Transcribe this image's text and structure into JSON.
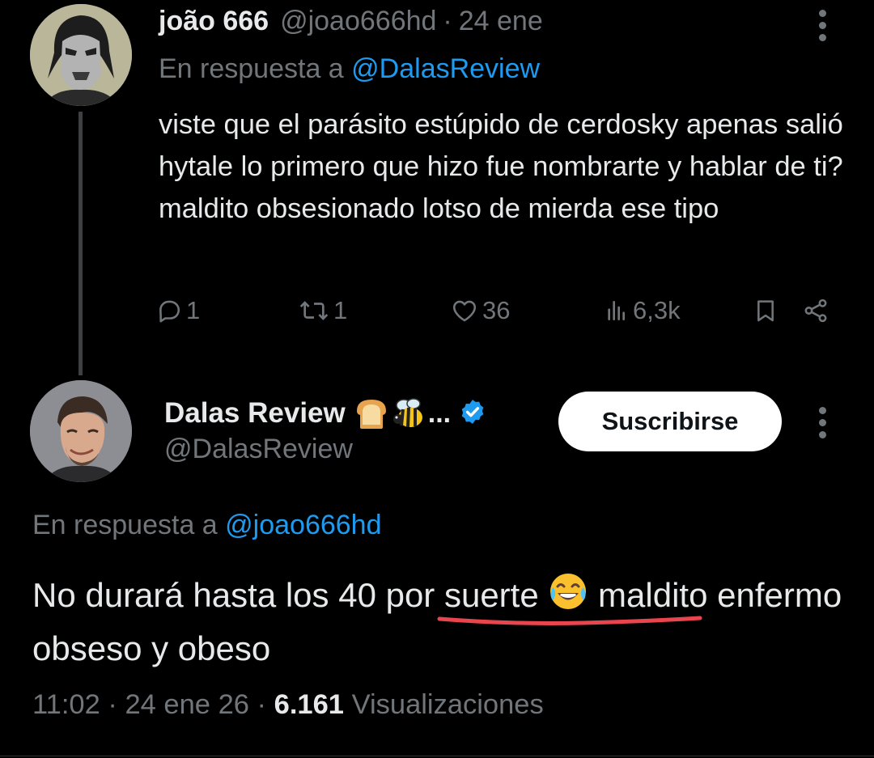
{
  "tweet1": {
    "author_name": "joão 666",
    "author_handle": "@joao666hd",
    "separator": "·",
    "date": "24 ene",
    "reply_prefix": "En respuesta a",
    "reply_handle": "@DalasReview",
    "text": "viste que el parásito estúpido de cerdosky apenas salió hytale lo primero que hizo fue nombrarte y hablar de ti? maldito obsesionado lotso de mierda ese tipo",
    "actions": {
      "replies": "1",
      "reposts": "1",
      "likes": "36",
      "views": "6,3k"
    },
    "icons": [
      "reply-icon",
      "repost-icon",
      "like-icon",
      "views-icon",
      "bookmark-icon",
      "share-icon",
      "more-icon"
    ]
  },
  "tweet2": {
    "author_name": "Dalas Review",
    "name_emojis": "🍞🐝",
    "name_ellipsis": "...",
    "author_handle": "@DalasReview",
    "subscribe_label": "Suscribirse",
    "reply_prefix": "En respuesta a",
    "reply_handle": "@joao666hd",
    "text_part1": "No durará hasta los 40 por suerte",
    "text_emoji": "😂",
    "text_part2": "maldito enfermo obseso y obeso",
    "time": "11:02",
    "sep1": "·",
    "date": "24 ene 26",
    "sep2": "·",
    "view_count": "6.161",
    "views_label": "Visualizaciones"
  },
  "colors": {
    "background": "#000000",
    "text": "#e7e9ea",
    "muted": "#71767b",
    "link": "#1d9bf0",
    "verified": "#1d9bf0",
    "annotation_underline": "#e8454f"
  }
}
